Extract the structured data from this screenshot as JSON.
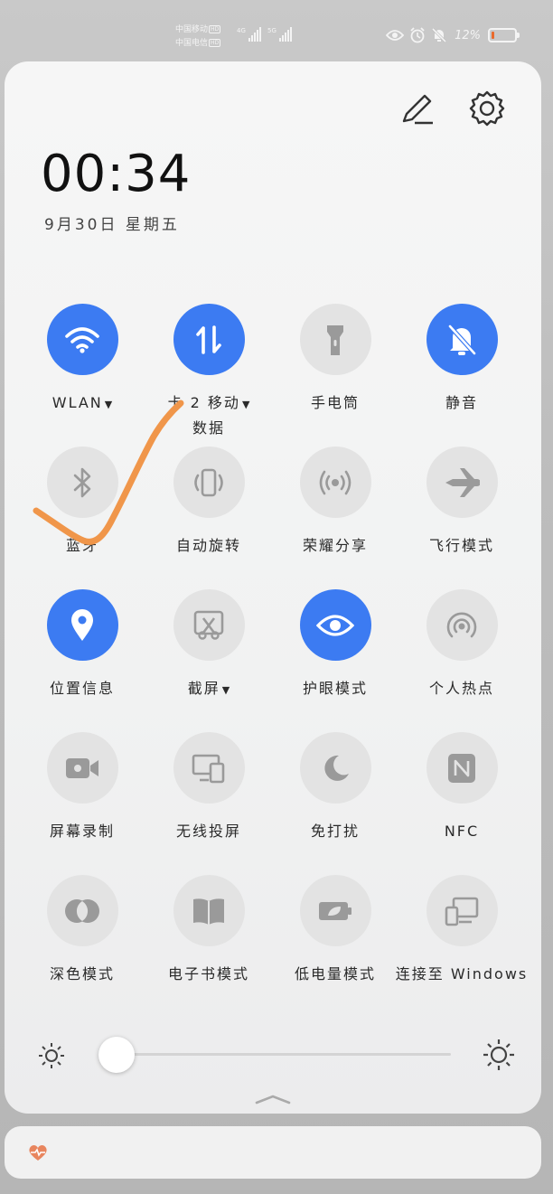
{
  "status_bar": {
    "carrier_1": "中国移动",
    "carrier_2": "中国电信",
    "hd": "HD",
    "net_1": "4G",
    "net_2": "5G",
    "battery_percent": "12%",
    "battery_level": 0.12,
    "battery_color": "#e96a2c"
  },
  "panel": {
    "edit_icon": "pencil-icon",
    "settings_icon": "gear-icon",
    "time": "00:34",
    "date": "9月30日 星期五"
  },
  "tiles": [
    {
      "label": "WLAN",
      "caret": "▼",
      "active": true,
      "icon": "wifi-icon"
    },
    {
      "label": "卡 2 移动",
      "label2": "数据",
      "caret": "▼",
      "active": true,
      "icon": "mobile-data-icon"
    },
    {
      "label": "手电筒",
      "active": false,
      "icon": "flashlight-icon"
    },
    {
      "label": "静音",
      "active": true,
      "icon": "bell-off-icon"
    },
    {
      "label": "蓝牙",
      "active": false,
      "icon": "bluetooth-icon"
    },
    {
      "label": "自动旋转",
      "active": false,
      "icon": "rotate-icon"
    },
    {
      "label": "荣耀分享",
      "active": false,
      "icon": "share-signal-icon"
    },
    {
      "label": "飞行模式",
      "active": false,
      "icon": "airplane-icon"
    },
    {
      "label": "位置信息",
      "active": true,
      "icon": "location-pin-icon"
    },
    {
      "label": "截屏",
      "caret": "▼",
      "active": false,
      "icon": "screenshot-icon"
    },
    {
      "label": "护眼模式",
      "active": true,
      "icon": "eye-icon"
    },
    {
      "label": "个人热点",
      "active": false,
      "icon": "hotspot-icon"
    },
    {
      "label": "屏幕录制",
      "active": false,
      "icon": "video-camera-icon"
    },
    {
      "label": "无线投屏",
      "active": false,
      "icon": "cast-devices-icon"
    },
    {
      "label": "免打扰",
      "active": false,
      "icon": "moon-icon"
    },
    {
      "label": "NFC",
      "active": false,
      "icon": "nfc-icon"
    },
    {
      "label": "深色模式",
      "active": false,
      "icon": "dark-mode-icon"
    },
    {
      "label": "电子书模式",
      "active": false,
      "icon": "book-icon"
    },
    {
      "label": "低电量模式",
      "active": false,
      "icon": "battery-leaf-icon"
    },
    {
      "label": "连接至 Windows",
      "active": false,
      "icon": "connect-pc-icon"
    }
  ],
  "brightness": {
    "level": 0.0,
    "min_icon": "sun-small-icon",
    "max_icon": "sun-large-icon"
  },
  "notification": {
    "icon": "heart-pulse-icon"
  },
  "colors": {
    "accent": "#3c7bf2",
    "tile_off": "#e3e3e3",
    "annotation": "#f0964a"
  }
}
